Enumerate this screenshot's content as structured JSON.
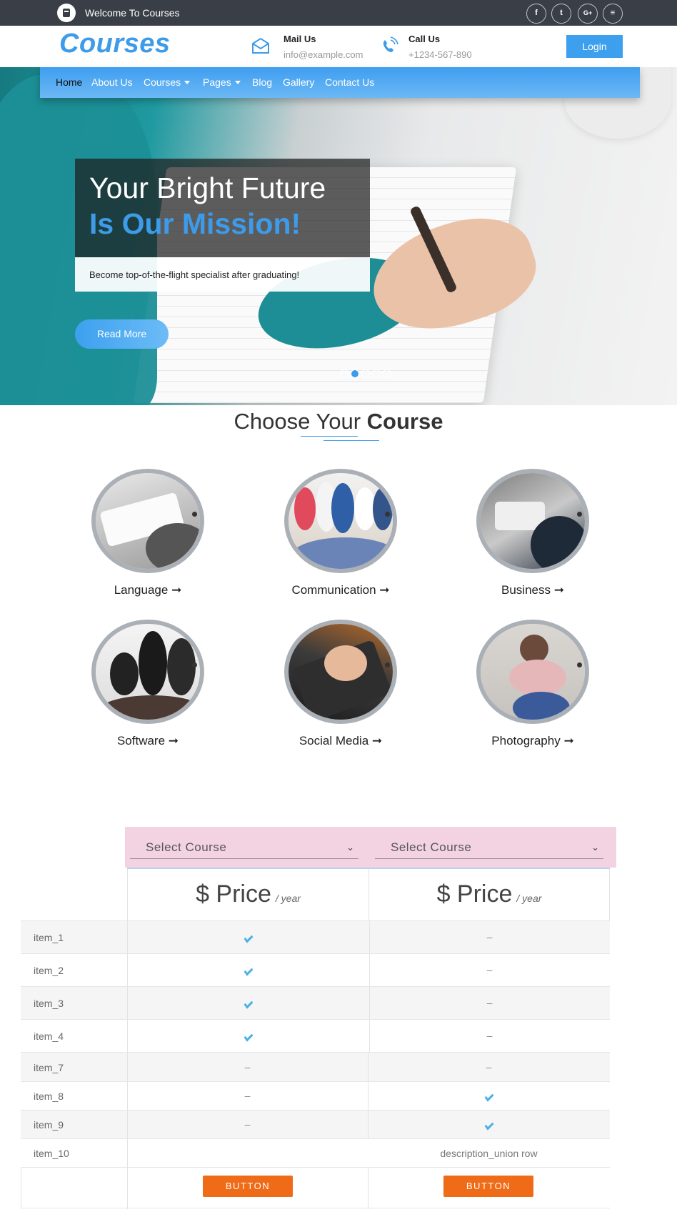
{
  "topbar": {
    "welcome": "Welcome To Courses",
    "social": [
      {
        "icon": "facebook-icon",
        "glyph": "f"
      },
      {
        "icon": "twitter-icon",
        "glyph": "t"
      },
      {
        "icon": "google-plus-icon",
        "glyph": "G+"
      },
      {
        "icon": "rss-icon",
        "glyph": "≡"
      }
    ]
  },
  "header": {
    "logo": "Courses",
    "mail": {
      "title": "Mail Us",
      "value": "info@example.com"
    },
    "call": {
      "title": "Call Us",
      "value": "+1234-567-890"
    },
    "login": "Login"
  },
  "nav": {
    "items": [
      {
        "label": "Home",
        "active": true
      },
      {
        "label": "About Us"
      },
      {
        "label": "Courses",
        "dropdown": true
      },
      {
        "label": "Pages",
        "dropdown": true
      },
      {
        "label": "Blog"
      },
      {
        "label": "Gallery"
      },
      {
        "label": "Contact Us"
      }
    ]
  },
  "hero": {
    "line1": "Your Bright Future",
    "line2": "Is Our Mission!",
    "subtitle": "Become top-of-the-flight specialist after graduating!",
    "cta": "Read More",
    "slides": 5,
    "active_slide": 2
  },
  "courses": {
    "title_pre": "Choose Your",
    "title_bold": "Course",
    "arrow": "➞",
    "items": [
      {
        "label": "Language"
      },
      {
        "label": "Communication"
      },
      {
        "label": "Business"
      },
      {
        "label": "Software"
      },
      {
        "label": "Social Media"
      },
      {
        "label": "Photography"
      }
    ]
  },
  "pricing": {
    "select_placeholder": "Select Course",
    "price_label": "$ Price",
    "per": "/ year",
    "rows": [
      {
        "label": "item_1",
        "c1": "check",
        "c2": "dash"
      },
      {
        "label": "item_2",
        "c1": "check",
        "c2": "dash"
      },
      {
        "label": "item_3",
        "c1": "check",
        "c2": "dash"
      },
      {
        "label": "item_4",
        "c1": "check",
        "c2": "dash"
      },
      {
        "label": "item_7",
        "c1": "dash",
        "c2": "dash"
      },
      {
        "label": "item_8",
        "c1": "dash",
        "c2": "check"
      },
      {
        "label": "item_9",
        "c1": "dash",
        "c2": "check"
      },
      {
        "label": "item_10",
        "union": "description_union row"
      }
    ],
    "button": "BUTTON"
  },
  "colors": {
    "accent": "#3d9be9",
    "topbar": "#3a3f47",
    "button": "#f06b17",
    "select_bg": "#f3d3e2"
  }
}
